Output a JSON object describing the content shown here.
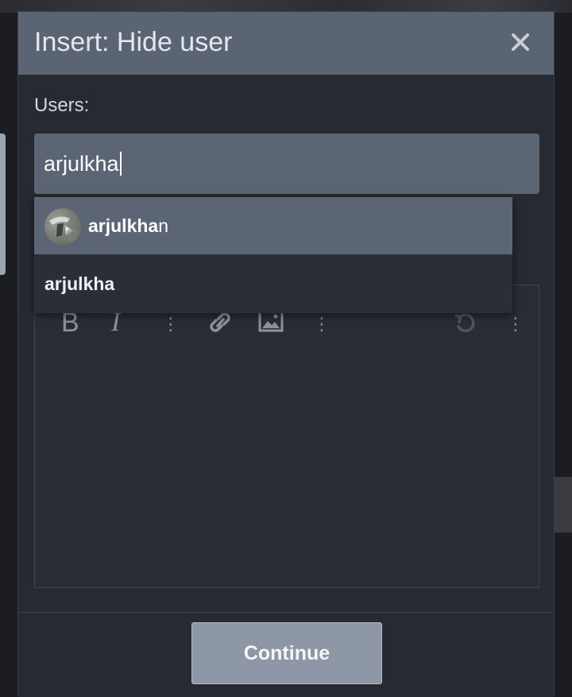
{
  "dialog": {
    "title": "Insert: Hide user",
    "close_icon": "close-icon"
  },
  "users_field": {
    "label": "Users:",
    "value": "arjulkha"
  },
  "suggestions": [
    {
      "match": "arjulkha",
      "rest": "n",
      "has_avatar": true,
      "selected": true
    },
    {
      "match": "arjulkha",
      "rest": "",
      "has_avatar": false,
      "selected": false
    }
  ],
  "editor_toolbar": {
    "bold": "B",
    "italic": "I",
    "icons": [
      "bold-icon",
      "italic-icon",
      "more-options-icon",
      "link-icon",
      "image-icon",
      "more-options-icon",
      "undo-icon",
      "more-options-icon"
    ]
  },
  "footer": {
    "continue_label": "Continue"
  },
  "colors": {
    "header": "#5b6473",
    "dialog_bg": "#272a31",
    "input_bg": "#5c6574",
    "button_bg": "#8e97a5"
  }
}
